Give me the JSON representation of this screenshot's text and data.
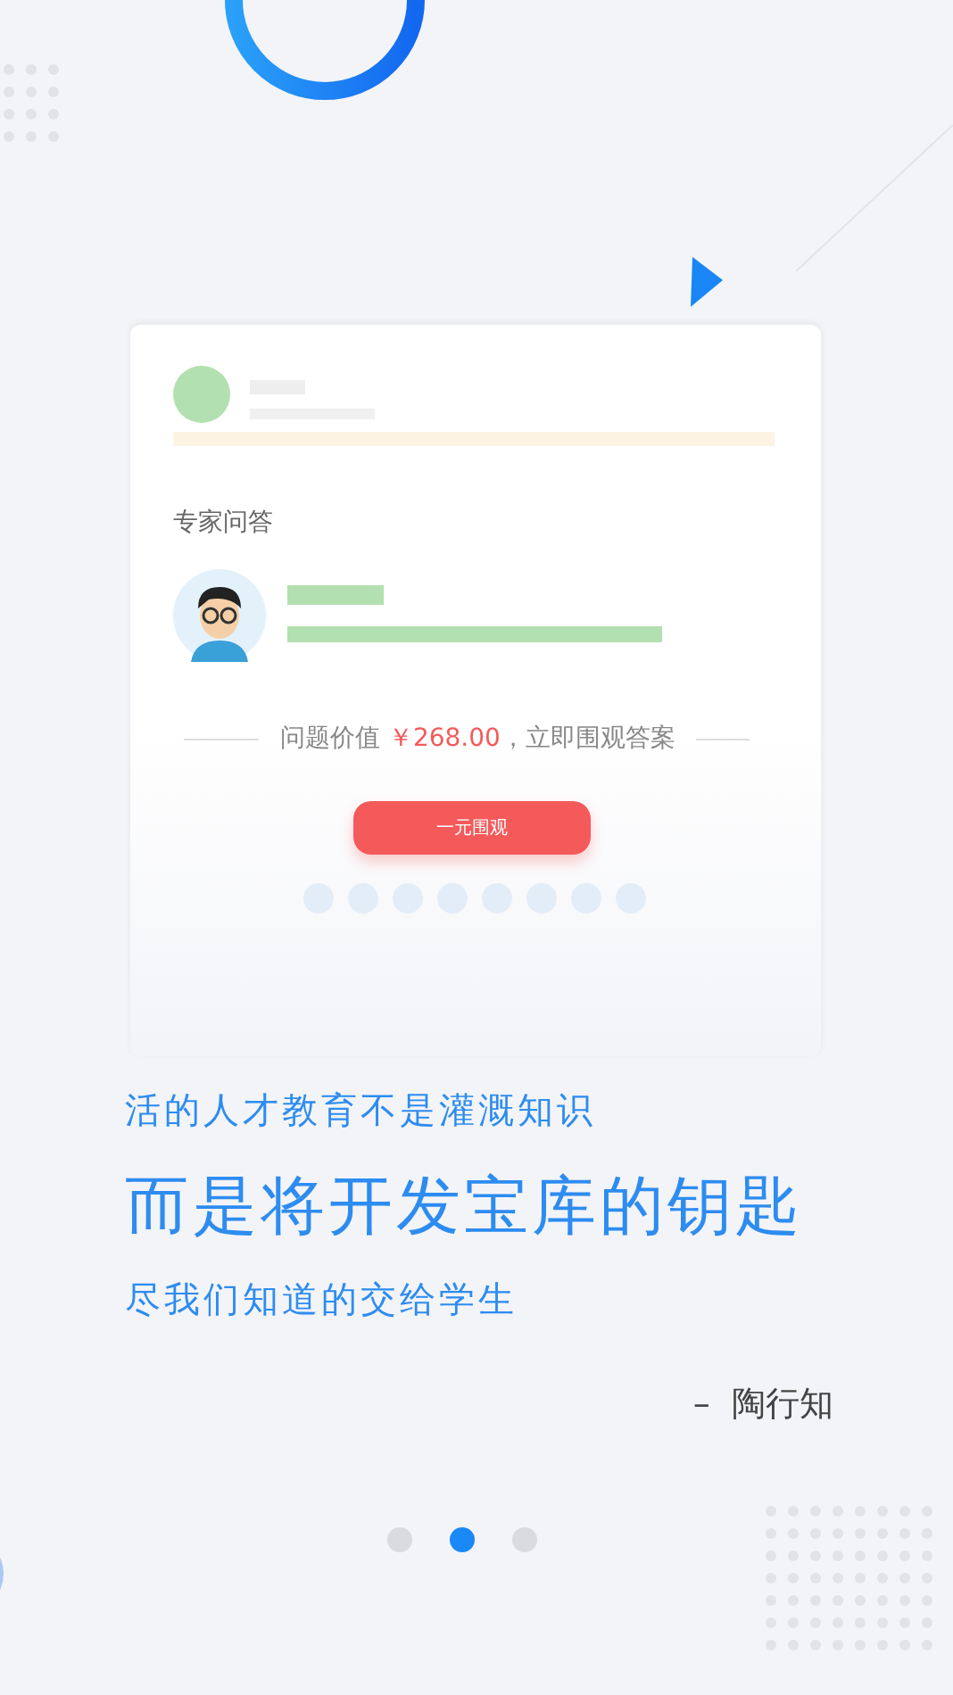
{
  "card": {
    "section_title": "专家问答",
    "price_prefix": "问题价值",
    "price": "￥268.00",
    "price_suffix": "，立即围观答案",
    "button": "一元围观",
    "dot_count_slots": [
      {
        "selected": false
      },
      {
        "selected": false
      },
      {
        "selected": false
      },
      {
        "selected": false
      },
      {
        "selected": false
      },
      {
        "selected": false
      },
      {
        "selected": false
      },
      {
        "selected": false
      }
    ]
  },
  "quote": {
    "line_1": "活的人才教育不是灌溉知识",
    "line_2": "而是将开发宝库的钥匙",
    "line_3": "尽我们知道的交给学生",
    "author": "–  陶行知"
  },
  "pager": [
    {
      "selected": false
    },
    {
      "selected": true
    },
    {
      "selected": false
    }
  ]
}
